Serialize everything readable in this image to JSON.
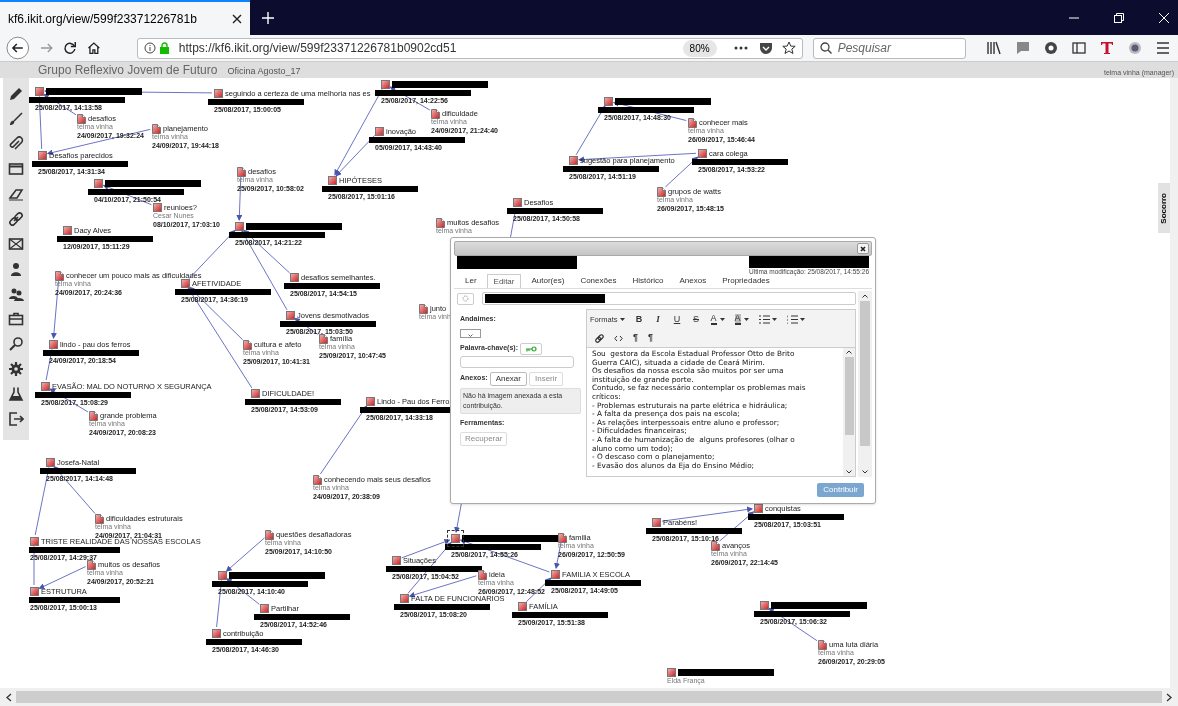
{
  "browser": {
    "tabs": [
      {
        "title": "kf6.ikit.org/view/599f23371226781b",
        "selected": true
      }
    ],
    "url": "https://kf6.ikit.org/view/599f23371226781b0902cd51",
    "zoom": "80%",
    "search_placeholder": "Pesquisar"
  },
  "header": {
    "title": "Grupo Reflexivo Jovem de Futuro",
    "view": "Oficina Agosto_17",
    "user": "telma vinha (manager)"
  },
  "side_tab": "Socorro",
  "notes": [
    {
      "kind": "note",
      "title_redacted": true,
      "author_redacted": true,
      "date": "25/08/2017, 14:22:56",
      "selected": false
    },
    {
      "kind": "note",
      "title_redacted": true,
      "author_redacted": true,
      "date": "25/08/2017, 14:13:58",
      "selected": false
    },
    {
      "kind": "note",
      "title": "seguindo a certeza de uma melhoria nas es",
      "author_redacted": true,
      "date": "25/08/2017, 15:00:05",
      "selected": false
    },
    {
      "kind": "note",
      "title_redacted": true,
      "author_redacted": true,
      "date": "25/08/2017, 14:48:30",
      "selected": false
    },
    {
      "kind": "buildon",
      "title": "dificuldade",
      "author": "telma vinha",
      "date": "24/09/2017, 21:24:40",
      "selected": false
    },
    {
      "kind": "buildon",
      "title": "desafios",
      "author": "telma vinha",
      "date": "24/09/2017, 19:32:24",
      "selected": false
    },
    {
      "kind": "buildon",
      "title": "conhecer mais",
      "author": "telma vinha",
      "date": "26/09/2017, 15:46:44",
      "selected": false
    },
    {
      "kind": "buildon",
      "title": "planejamento",
      "author": "telma vinha",
      "date": "24/09/2017, 19:44:18",
      "selected": false
    },
    {
      "kind": "note",
      "title": "inovação",
      "author_redacted": true,
      "date": "05/09/2017, 14:43:40",
      "selected": false
    },
    {
      "kind": "note",
      "title": "Desafios parecidos",
      "author_redacted": true,
      "date": "25/08/2017, 14:31:34",
      "selected": false
    },
    {
      "kind": "note",
      "title": "sugestão para planejamento",
      "author_redacted": true,
      "date": "25/08/2017, 14:51:19",
      "selected": false
    },
    {
      "kind": "note",
      "title": "cara colega",
      "author_redacted": true,
      "date": "25/08/2017, 14:53:22",
      "selected": false
    },
    {
      "kind": "buildon",
      "title": "desafios",
      "author": "telma vinha",
      "date": "25/09/2017, 10:58:02",
      "selected": false
    },
    {
      "kind": "note",
      "title_redacted": true,
      "author_redacted": true,
      "date": "04/10/2017, 21:50:54",
      "selected": false
    },
    {
      "kind": "note",
      "title": "HIPÓTESES",
      "author_redacted": true,
      "date": "25/08/2017, 15:01:16",
      "selected": false
    },
    {
      "kind": "buildon",
      "title": "grupos de watts",
      "author": "telma vinha",
      "date": "26/09/2017, 15:48:15",
      "selected": false
    },
    {
      "kind": "note",
      "title": "reunioes?",
      "author": "Cesar Nunes",
      "date": "08/10/2017, 17:03:10",
      "selected": false
    },
    {
      "kind": "note",
      "title": "Desafios",
      "author_redacted": true,
      "date": "25/08/2017, 14:50:58",
      "selected": false
    },
    {
      "kind": "buildon",
      "title": "muitos desafios",
      "author": "telma vinha",
      "selected": false
    },
    {
      "kind": "note",
      "title": "Dacy Alves",
      "author_redacted": true,
      "date": "12/09/2017, 15:11:29",
      "selected": false
    },
    {
      "kind": "note",
      "title_redacted": true,
      "author_redacted": true,
      "date": "25/08/2017, 14:21:22",
      "selected": false
    },
    {
      "kind": "buildon",
      "title": "conhecer um pouco mais as dificuldades",
      "author": "telma vinha",
      "date": "24/09/2017, 20:24:36",
      "selected": false
    },
    {
      "kind": "note",
      "title": "AFETIVIDADE",
      "author_redacted": true,
      "date": "25/08/2017, 14:36:19",
      "selected": false
    },
    {
      "kind": "note",
      "title": "desafios semelhantes.",
      "author_redacted": true,
      "date": "25/08/2017, 14:54:15",
      "selected": false
    },
    {
      "kind": "buildon",
      "title": "junto",
      "author": "telma vinh",
      "selected": false
    },
    {
      "kind": "note",
      "title": "Jovens desmotivados",
      "author_redacted": true,
      "date": "25/08/2017, 15:03:50",
      "selected": false
    },
    {
      "kind": "buildon",
      "title": "família",
      "author": "telma vinha",
      "date": "25/09/2017, 10:47:45",
      "selected": false
    },
    {
      "kind": "note",
      "title": "lindo - pau dos ferros",
      "author_redacted": true,
      "date": "24/09/2017, 20:18:54",
      "selected": false
    },
    {
      "kind": "buildon",
      "title": "cultura e afeto",
      "author": "telma vinha",
      "date": "25/09/2017, 10:41:31",
      "selected": false
    },
    {
      "kind": "note",
      "title": "EVASÃO: MAL DO NOTURNO X SEGURANÇA",
      "author_redacted": true,
      "date": "25/08/2017, 15:08:29",
      "selected": false
    },
    {
      "kind": "note",
      "title": "DIFICULDADE!",
      "author_redacted": true,
      "date": "25/08/2017, 14:53:09",
      "selected": false
    },
    {
      "kind": "note",
      "title": "Lindo - Pau dos Ferro",
      "author_redacted": true,
      "date": "25/08/2017, 14:33:18",
      "selected": false
    },
    {
      "kind": "buildon",
      "title": "grande problema",
      "author": "telma vinha",
      "date": "24/09/2017, 20:08:23",
      "selected": false
    },
    {
      "kind": "note",
      "title": "Josefa-Natal",
      "author_redacted": true,
      "date": "25/08/2017, 14:14:48",
      "selected": false
    },
    {
      "kind": "buildon",
      "title": "conhecendo mais seus desafios",
      "author": "telma vinha",
      "date": "24/09/2017, 20:38:09",
      "selected": false
    },
    {
      "kind": "note",
      "title": "conquistas",
      "author_redacted": true,
      "date": "25/08/2017, 15:03:51",
      "selected": false
    },
    {
      "kind": "buildon",
      "title": "dificuldades estruturais",
      "author": "telma vinha",
      "date": "24/09/2017, 21:04:31",
      "selected": false
    },
    {
      "kind": "note",
      "title": "Parabéns!",
      "author_redacted": true,
      "date": "25/08/2017, 15:10:16",
      "selected": false
    },
    {
      "kind": "note",
      "title": "TRISTE REALIDADE DAS NOSSAS ESCOLAS",
      "author_redacted": true,
      "date": "25/08/2017, 14:29:37",
      "selected": false
    },
    {
      "kind": "buildon",
      "title": "questões desafiadoras",
      "author": "telma vinha",
      "date": "25/09/2017, 14:10:50",
      "selected": false
    },
    {
      "kind": "note",
      "title_redacted": true,
      "author_redacted": true,
      "date": "25/08/2017, 14:55:26",
      "selected": true
    },
    {
      "kind": "buildon",
      "title": "familia",
      "author": "telma vinha",
      "date": "26/09/2017, 12:50:59",
      "selected": false
    },
    {
      "kind": "buildon",
      "title": "avanços",
      "author": "telma vinha",
      "date": "26/09/2017, 22:14:45",
      "selected": false
    },
    {
      "kind": "buildon",
      "title": "muitos os desafios",
      "author": "telma vinha",
      "date": "24/09/2017, 20:52:21",
      "selected": false
    },
    {
      "kind": "note",
      "title": "Situações",
      "author_redacted": true,
      "date": "25/08/2017, 15:04:52",
      "selected": false
    },
    {
      "kind": "note",
      "title_redacted": true,
      "author_redacted": true,
      "date": "25/08/2017, 14:10:40",
      "selected": false
    },
    {
      "kind": "buildon",
      "title": "ideia",
      "author": "telma vinha",
      "date": "26/09/2017, 12:48:52",
      "selected": false
    },
    {
      "kind": "note",
      "title": "FAMILIA X ESCOLA",
      "author_redacted": true,
      "date": "25/08/2017, 14:49:05",
      "selected": false
    },
    {
      "kind": "note",
      "title": "ESTRUTURA",
      "author_redacted": true,
      "date": "25/08/2017, 15:00:13",
      "selected": false
    },
    {
      "kind": "note",
      "title": "FALTA DE FUNCIONARIOS",
      "author_redacted": true,
      "date": "25/08/2017, 15:08:20",
      "selected": false
    },
    {
      "kind": "note",
      "title": "Partilhar",
      "author_redacted": true,
      "date": "25/08/2017, 14:52:46",
      "selected": false
    },
    {
      "kind": "note",
      "title": "FAMÍLIA",
      "author_redacted": true,
      "date": "25/09/2017, 15:51:38",
      "selected": false
    },
    {
      "kind": "note",
      "title_redacted": true,
      "author_redacted": true,
      "date": "25/08/2017, 15:06:32",
      "selected": false
    },
    {
      "kind": "note",
      "title": "contribuição",
      "author_redacted": true,
      "date": "25/08/2017, 14:46:30",
      "selected": false
    },
    {
      "kind": "buildon",
      "title": "uma luta diária",
      "author": "telma vinha",
      "date": "26/09/2017, 20:29:05",
      "selected": false
    },
    {
      "kind": "note",
      "title_redacted": true,
      "author": "Elda França",
      "selected": false
    }
  ],
  "dialog": {
    "header_redacted": true,
    "modified": "Última modificação: 25/08/2017, 14:55:26",
    "tabs": [
      {
        "label": "Ler",
        "selected": false
      },
      {
        "label": "Editar",
        "selected": true
      },
      {
        "label": "Autor(es)",
        "selected": false
      },
      {
        "label": "Conexões",
        "selected": false
      },
      {
        "label": "Histórico",
        "selected": false
      },
      {
        "label": "Anexos",
        "selected": false
      },
      {
        "label": "Propriedades",
        "selected": false
      }
    ],
    "title_redacted": true,
    "scaffolds_label": "Andaimes:",
    "keywords_label": "Palavra-chave(s):",
    "attachments_label": "Anexos:",
    "attachment_buttons": [
      {
        "label": "Anexar",
        "disabled": false
      },
      {
        "label": "Inserir",
        "disabled": true
      }
    ],
    "attachment_notice": "Não há imagem anexada a esta contribuição.",
    "tools_label": "Ferramentas:",
    "tool_buttons": [
      {
        "label": "Recuperar",
        "disabled": true
      }
    ],
    "format_menu": "Formats",
    "style_buttons": [
      "B",
      "I",
      "U",
      "S"
    ],
    "color_buttons": [
      "A",
      "A"
    ],
    "direction_buttons": [
      "¶",
      "¶"
    ],
    "body_lines": [
      "Sou  gestora da Escola Estadual Professor Otto de Brito",
      "Guerra CAIC), situada a cidade de Ceará Mirim.",
      "Os desafios da nossa escola são muitos por ser uma",
      "instituição de grande porte.",
      "Contudo, se faz necessário contemplar os problemas mais",
      "críticos:",
      "- Problemas estruturais na parte elétrica e hidráulica;",
      "- A falta da presença dos pais na escola;",
      "- As relações interpessoais entre aluno e professor;",
      "- Dificuldades financeiras;",
      "- A falta de humanização de  alguns profesores (olhar o",
      "aluno como um todo);",
      "- O descaso com o planejamento;",
      "- Evasão dos alunos da Eja do Ensino Médio;"
    ],
    "submit": "Contribuir"
  }
}
